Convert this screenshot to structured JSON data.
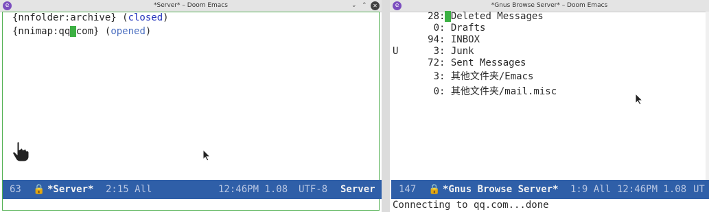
{
  "left_window": {
    "title": "*Server* – Doom Emacs",
    "app_icon": "emacs-icon",
    "buttons": {
      "minimize": "⌄",
      "maximize": "⌃",
      "close": "✕"
    },
    "lines": [
      {
        "prefix": "{nnfolder:archive} (",
        "status": "closed",
        "suffix": ")"
      },
      {
        "prefix_a": "{nnimap:qq",
        "cursor_char": ".",
        "prefix_b": "com} (",
        "status": "opened",
        "suffix": ")"
      }
    ],
    "modeline": {
      "line_number": "63",
      "buffer_name": "*Server*",
      "position": "2:15 All",
      "time": "12:46PM 1.08",
      "encoding": "UTF-8",
      "mode": "Server"
    },
    "colors": {
      "frame_border": "#53b153",
      "cursor": "#3cb043",
      "modeline": "#2f5fa8"
    }
  },
  "right_window": {
    "title": "*Gnus Browse Server* – Doom Emacs",
    "buttons": {
      "minimize": "⌄",
      "maximize": "⌃",
      "close": "✕"
    },
    "mailboxes": [
      {
        "flag": "",
        "count": "28",
        "name": "Deleted Messages"
      },
      {
        "flag": "",
        "count": "0",
        "name": "Drafts"
      },
      {
        "flag": "",
        "count": "94",
        "name": "INBOX"
      },
      {
        "flag": "U",
        "count": "3",
        "name": "Junk"
      },
      {
        "flag": "",
        "count": "72",
        "name": "Sent Messages"
      },
      {
        "flag": "",
        "count": "3",
        "name": "其他文件夹/Emacs"
      },
      {
        "flag": "",
        "count": "0",
        "name": "其他文件夹/mail.misc"
      }
    ],
    "modeline": {
      "line_number": "147",
      "buffer_name": "*Gnus Browse Server*",
      "position": "1:9 All",
      "time": "12:46PM 1.08",
      "encoding": "UT"
    },
    "minibuffer": "Connecting to qq.com...done"
  }
}
